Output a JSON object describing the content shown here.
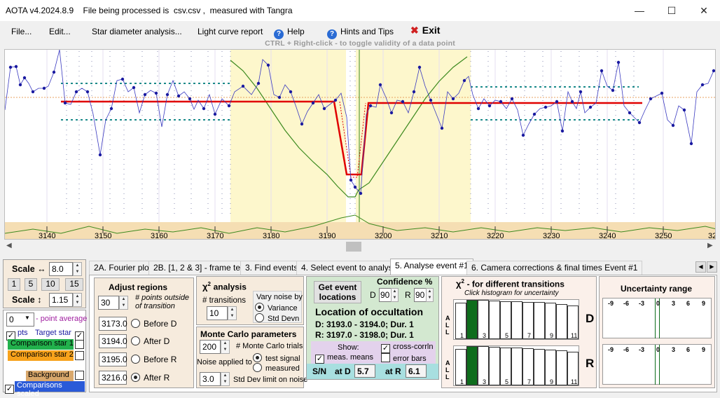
{
  "window": {
    "title": "AOTA v4.2024.8.9    File being processed is  csv.csv ,  measured with Tangra"
  },
  "menu": {
    "file": "File...",
    "edit": "Edit...",
    "star_diameter": "Star diameter analysis...",
    "light_curve": "Light curve report",
    "help": "Help",
    "hints": "Hints and Tips",
    "exit": "Exit"
  },
  "hint_text": "CTRL + Right-click    -  to toggle validity of a data point",
  "plot": {
    "x_ticks": [
      "3140",
      "3150",
      "3160",
      "3170",
      "3180",
      "3190",
      "3200",
      "3210",
      "3220",
      "3230",
      "3240",
      "3250",
      "32"
    ]
  },
  "left": {
    "scale_h_label": "Scale ↔",
    "scale_h_value": "8.0",
    "preset_1": "1",
    "preset_5": "5",
    "preset_10": "10",
    "preset_15": "15",
    "scale_v_label": "Scale ↕",
    "scale_v_value": "1.15",
    "avg_value": "0",
    "avg_label": "- point average",
    "pts_label": "pts",
    "target_label": "Target star",
    "comp1_label": "Comparison star 1",
    "comp2_label": "Comparison star 2",
    "background_label": "Background",
    "comps_scaled_label": "Comparisons scaled"
  },
  "tabs": [
    "2A. Fourier plot",
    "2B. [1, 2 & 3] - frame test",
    "3. Find events",
    "4. Select event to analyse",
    "5. Analyse event #1",
    "6. Camera corrections & final times Event #1"
  ],
  "adjust": {
    "title": "Adjust regions",
    "points_value": "30",
    "points_label": "# points outside of transition",
    "rows": [
      {
        "value": "3173.0",
        "label": "Before D"
      },
      {
        "value": "3194.0",
        "label": "After D"
      },
      {
        "value": "3195.0",
        "label": "Before R"
      },
      {
        "value": "3216.0",
        "label": "After R"
      }
    ]
  },
  "chi": {
    "title_chi": "χ",
    "title_sup": "2",
    "title_rest": "analysis",
    "transitions_label": "# transitions",
    "transitions_value": "10",
    "vary_label": "Vary noise by",
    "variance": "Variance",
    "stddev": "Std Devn"
  },
  "monte": {
    "title": "Monte Carlo parameters",
    "trials_value": "200",
    "trials_label": "# Monte Carlo trials",
    "noise_label": "Noise applied to",
    "test_signal": "test signal",
    "measured": "measured",
    "sd_value": "3.0",
    "sd_label": "Std Dev limit on noise"
  },
  "event": {
    "get_btn_line1": "Get event",
    "get_btn_line2": "locations",
    "conf_label": "Confidence %",
    "d_label": "D",
    "d_value": "90",
    "r_label": "R",
    "r_value": "90",
    "location_title": "Location of occultation",
    "d_line": "D: 3193.0 - 3194.0; Dur. 1",
    "r_line": "R: 3197.0 - 3198.0; Dur. 1",
    "show_label": "Show:",
    "meas_means": "meas. means",
    "cross_corr": "cross-corrln",
    "error_bars": "error bars",
    "sn_label": "S/N",
    "at_d": "at D",
    "at_d_value": "5.7",
    "at_r": "at R",
    "at_r_value": "6.1"
  },
  "chi_hist": {
    "title_chi": "χ",
    "title_sup": "2",
    "title_rest": "- for different transitions",
    "subtitle": "Click histogram for uncertainty",
    "all_label": [
      "A",
      "L",
      "L"
    ],
    "x_labels": [
      "1",
      "3",
      "5",
      "7",
      "9",
      "11"
    ],
    "d_letter": "D",
    "r_letter": "R"
  },
  "uncert": {
    "title": "Uncertainty range",
    "ticks": [
      "-9",
      "-6",
      "-3",
      "0",
      "3",
      "6",
      "9"
    ]
  },
  "colors": {
    "yellow_region": "#fdf7cc",
    "tan_band": "#f5deb3",
    "target_series": "#1a1aa0",
    "model_line": "#e00000",
    "green_curve": "#3d8a1f",
    "teal_dots": "#1a8a8a",
    "comp1_bg": "#22b14c",
    "comp2_bg": "#f7a21b",
    "comps_scaled_bg": "#2a5ad8",
    "hist_selected": "#0e6d1c",
    "sn_panel_bg": "#a8dfe0",
    "event_panel_bg": "#d3e8d0",
    "panel_bg": "#f6ebdd"
  }
}
